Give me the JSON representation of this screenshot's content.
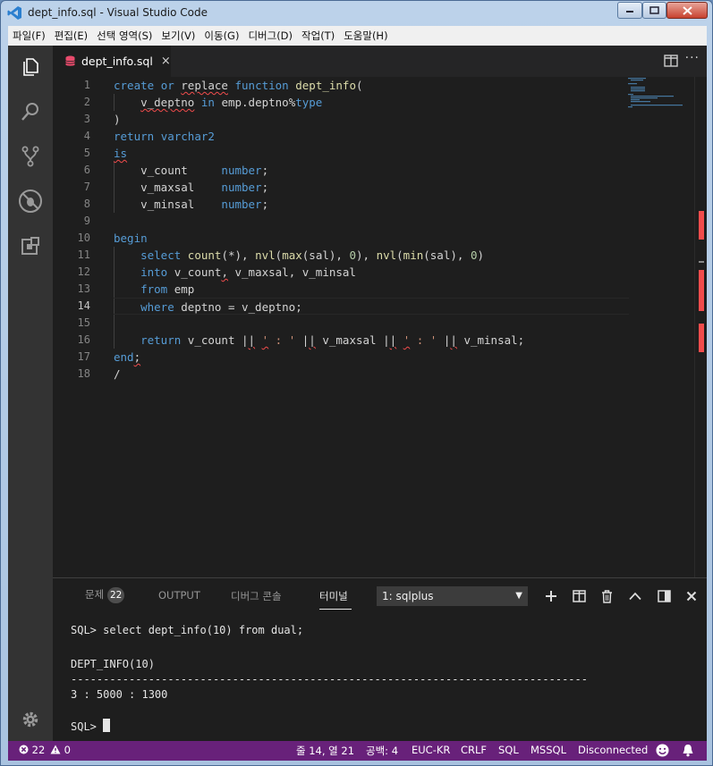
{
  "window": {
    "title": "dept_info.sql - Visual Studio Code"
  },
  "menu": [
    "파일(F)",
    "편집(E)",
    "선택 영역(S)",
    "보기(V)",
    "이동(G)",
    "디버그(D)",
    "작업(T)",
    "도움말(H)"
  ],
  "tab": {
    "label": "dept_info.sql",
    "close": "×"
  },
  "editor": {
    "line_numbers": [
      "1",
      "2",
      "3",
      "4",
      "5",
      "6",
      "7",
      "8",
      "9",
      "10",
      "11",
      "12",
      "13",
      "14",
      "15",
      "16",
      "17",
      "18"
    ],
    "active_line": 14
  },
  "panel": {
    "tabs": {
      "problems": "문제",
      "problems_count": "22",
      "output": "OUTPUT",
      "debug_console": "디버그 콘솔",
      "terminal": "터미널"
    },
    "terminal_select": "1: sqlplus",
    "terminal_lines": [
      "SQL> select dept_info(10) from dual;",
      "",
      "DEPT_INFO(10)",
      "--------------------------------------------------------------------------------",
      "3 : 5000 : 1300",
      "",
      "SQL> "
    ]
  },
  "statusbar": {
    "errors": "22",
    "warnings": "0",
    "position": "줄 14, 열 21",
    "spaces": "공백: 4",
    "encoding": "EUC-KR",
    "eol": "CRLF",
    "language": "SQL",
    "dialect": "MSSQL",
    "connection": "Disconnected"
  },
  "colors": {
    "statusbar": "#68217a",
    "keyword": "#569cd6",
    "function": "#dcdcaa",
    "number": "#b5cea8",
    "string": "#ce9178",
    "error": "#f14c4c"
  }
}
